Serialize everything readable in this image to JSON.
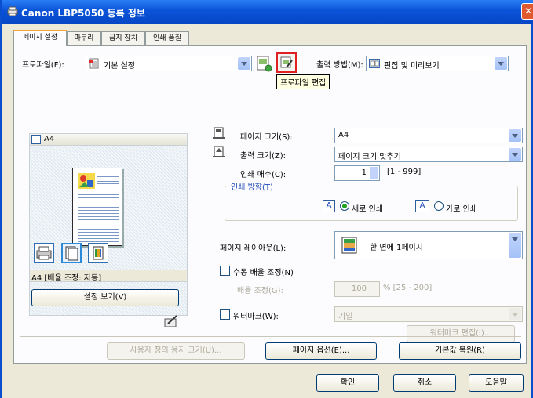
{
  "window": {
    "title": "Canon LBP5050 등록 정보",
    "close_glyph": "✕"
  },
  "tabs": [
    {
      "label": "페이지 설정",
      "active": true
    },
    {
      "label": "마무리",
      "active": false
    },
    {
      "label": "급지 장치",
      "active": false
    },
    {
      "label": "인쇄 품질",
      "active": false
    }
  ],
  "profile": {
    "label": "프로파일(F):",
    "value": "기본 설정",
    "tooltip": "프로파일 편집"
  },
  "output_method": {
    "label": "출력 방법(M):",
    "value": "편집 및 미리보기"
  },
  "preview": {
    "title": "A4",
    "status": "A4 [배율 조정: 자동]"
  },
  "view_settings_button": "설정 보기(V)",
  "page_size": {
    "label": "페이지 크기(S):",
    "value": "A4"
  },
  "output_size": {
    "label": "출력 크기(Z):",
    "value": "페이지 크기 맞추기"
  },
  "copies": {
    "label": "인쇄 매수(C):",
    "value": "1",
    "range": "[1 - 999]"
  },
  "orientation": {
    "legend": "인쇄 방향(T)",
    "portrait": "세로 인쇄",
    "landscape": "가로 인쇄",
    "selected": "portrait"
  },
  "layout": {
    "label": "페이지 레이아웃(L):",
    "value": "한 면에 1페이지"
  },
  "manual_scaling": {
    "label": "수동 배율 조정(N)",
    "checked": false,
    "sub_label": "배율 조정(G):",
    "value": "100",
    "unit_range": "% [25 - 200]"
  },
  "watermark": {
    "label": "워터마크(W):",
    "checked": false,
    "value": "기밀",
    "edit_button": "워터마크 편집(I)..."
  },
  "bottom_buttons": {
    "custom_paper": "사용자 정의 용지 크기(U)...",
    "page_options": "페이지 옵션(E)...",
    "restore_defaults": "기본값 복원(R)"
  },
  "dialog_buttons": {
    "ok": "확인",
    "cancel": "취소",
    "help": "도움말"
  },
  "colors": {
    "accent": "#0a53d8",
    "highlight_border": "#e02020"
  }
}
